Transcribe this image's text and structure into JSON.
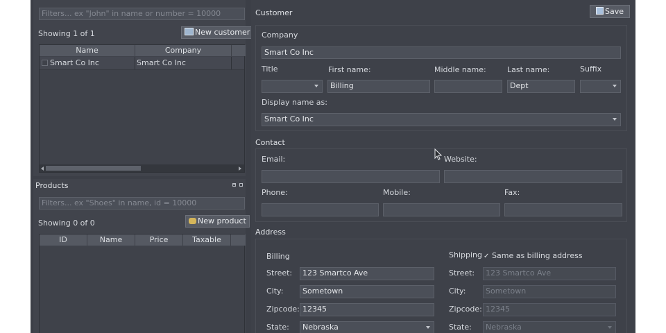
{
  "customers": {
    "filter_placeholder": "Filters... ex \"John\" in name or number = 10000",
    "showing": "Showing 1 of 1",
    "new_button": "New customer",
    "columns": [
      "Name",
      "Company"
    ],
    "rows": [
      {
        "name": "Smart Co Inc",
        "company": "Smart Co Inc"
      }
    ]
  },
  "products": {
    "title": "Products",
    "filter_placeholder": "Filters... ex \"Shoes\" in name, id = 10000",
    "showing": "Showing 0 of 0",
    "new_button": "New product",
    "columns": [
      "ID",
      "Name",
      "Price",
      "Taxable"
    ]
  },
  "customer": {
    "title": "Customer",
    "save_label": "Save",
    "company_label": "Company",
    "company_value": "Smart Co Inc",
    "title_label": "Title",
    "title_value": "",
    "first_name_label": "First name:",
    "first_name_value": "Billing",
    "middle_name_label": "Middle name:",
    "middle_name_value": "",
    "last_name_label": "Last name:",
    "last_name_value": "Dept",
    "suffix_label": "Suffix",
    "suffix_value": "",
    "display_name_label": "Display name as:",
    "display_name_value": "Smart Co Inc"
  },
  "contact": {
    "title": "Contact",
    "email_label": "Email:",
    "email_value": "",
    "website_label": "Website:",
    "website_value": "",
    "phone_label": "Phone:",
    "phone_value": "",
    "mobile_label": "Mobile:",
    "mobile_value": "",
    "fax_label": "Fax:",
    "fax_value": ""
  },
  "address": {
    "title": "Address",
    "billing": {
      "title": "Billing",
      "street_label": "Street:",
      "street": "123 Smartco Ave",
      "city_label": "City:",
      "city": "Sometown",
      "zip_label": "Zipcode:",
      "zip": "12345",
      "state_label": "State:",
      "state": "Nebraska"
    },
    "shipping": {
      "title": "Shipping",
      "same_label": "Same as billing address",
      "same_checked": true,
      "street_label": "Street:",
      "street": "123 Smartco Ave",
      "city_label": "City:",
      "city": "Sometown",
      "zip_label": "Zipcode:",
      "zip": "12345",
      "state_label": "State:",
      "state": "Nebraska"
    }
  },
  "colors": {
    "background": "#3c3f47",
    "panel": "#41444c",
    "field": "#4b4f58",
    "text": "#d6d9de"
  }
}
